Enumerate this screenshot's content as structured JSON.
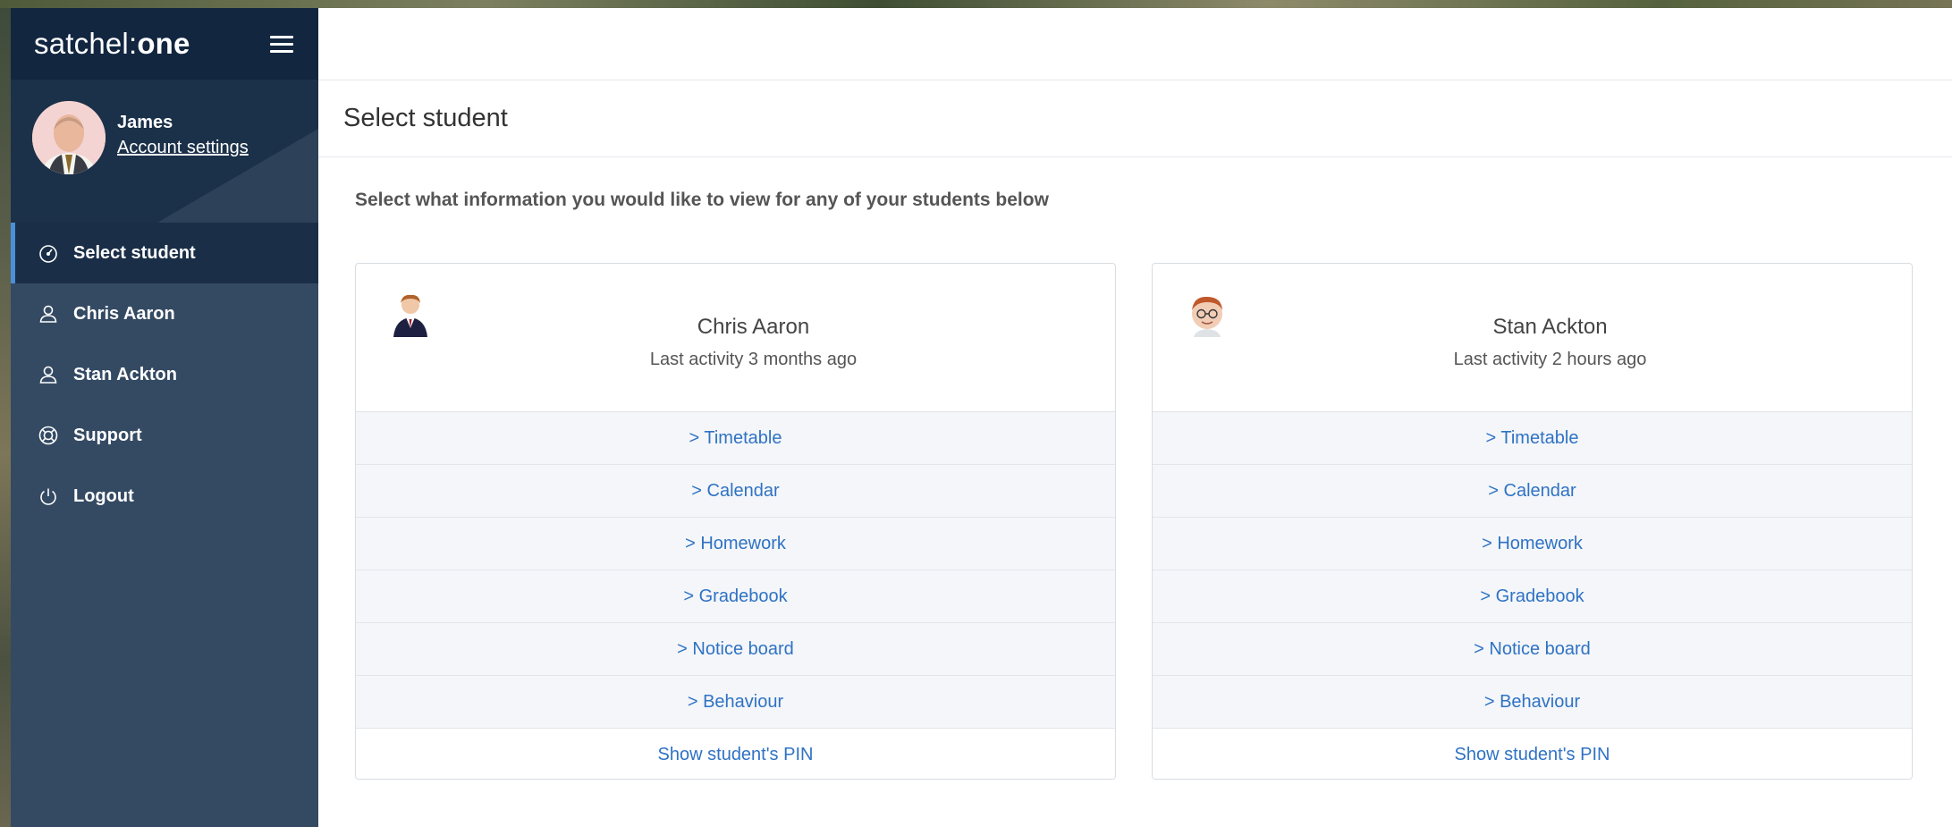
{
  "brand": {
    "logo_light": "satchel:",
    "logo_bold": "one"
  },
  "user": {
    "name": "James",
    "account_link": "Account settings"
  },
  "nav": {
    "items": [
      {
        "label": "Select student",
        "icon": "dashboard-icon"
      },
      {
        "label": "Chris Aaron",
        "icon": "user-icon"
      },
      {
        "label": "Stan Ackton",
        "icon": "user-icon"
      },
      {
        "label": "Support",
        "icon": "lifebuoy-icon"
      },
      {
        "label": "Logout",
        "icon": "power-icon"
      }
    ]
  },
  "page": {
    "title": "Select student",
    "intro": "Select what information you would like to view for any of your students below"
  },
  "students": [
    {
      "name": "Chris Aaron",
      "activity": "Last activity 3 months ago",
      "links": [
        "> Timetable",
        "> Calendar",
        "> Homework",
        "> Gradebook",
        "> Notice board",
        "> Behaviour"
      ],
      "pin_label": "Show student's PIN"
    },
    {
      "name": "Stan Ackton",
      "activity": "Last activity 2 hours ago",
      "links": [
        "> Timetable",
        "> Calendar",
        "> Homework",
        "> Gradebook",
        "> Notice board",
        "> Behaviour"
      ],
      "pin_label": "Show student's PIN"
    }
  ],
  "colors": {
    "sidebar": "#344a63",
    "sidebar_dark": "#122640",
    "accent": "#4a90d9",
    "link": "#2f72c4"
  }
}
